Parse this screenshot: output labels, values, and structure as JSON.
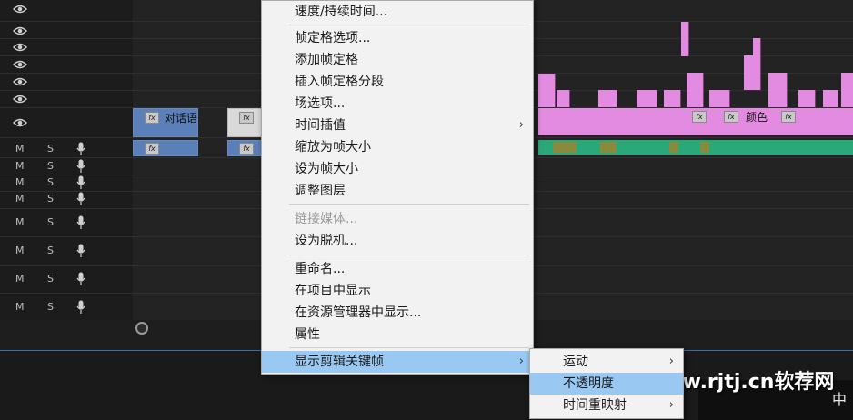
{
  "tracks": {
    "video_clip_1_label": "对话语",
    "video_clip_3_label": "颜色",
    "audio_btn_m": "M",
    "audio_btn_s": "S"
  },
  "context_menu": {
    "items": [
      {
        "label": "速度/持续时间...",
        "enabled": true
      },
      {
        "label": "帧定格选项...",
        "enabled": true
      },
      {
        "label": "添加帧定格",
        "enabled": true
      },
      {
        "label": "插入帧定格分段",
        "enabled": true
      },
      {
        "label": "场选项...",
        "enabled": true
      },
      {
        "label": "时间插值",
        "enabled": true,
        "submenu": true
      },
      {
        "label": "缩放为帧大小",
        "enabled": true
      },
      {
        "label": "设为帧大小",
        "enabled": true
      },
      {
        "label": "调整图层",
        "enabled": true
      },
      {
        "label": "链接媒体...",
        "enabled": false
      },
      {
        "label": "设为脱机...",
        "enabled": true
      },
      {
        "label": "重命名...",
        "enabled": true
      },
      {
        "label": "在项目中显示",
        "enabled": true
      },
      {
        "label": "在资源管理器中显示...",
        "enabled": true
      },
      {
        "label": "属性",
        "enabled": true
      },
      {
        "label": "显示剪辑关键帧",
        "enabled": true,
        "submenu": true,
        "highlighted": true
      }
    ]
  },
  "submenu": {
    "items": [
      {
        "label": "运动",
        "submenu": true
      },
      {
        "label": "不透明度",
        "highlighted": true
      },
      {
        "label": "时间重映射",
        "submenu": true
      }
    ]
  },
  "watermark": "www.rjtj.cn软荐网",
  "taskbar": {
    "ime": "中"
  },
  "colors": {
    "menu_bg": "#f2f2f2",
    "highlight": "#99c9f2",
    "clip_pink": "#e38be0",
    "clip_blue": "#5b7fb8",
    "audio_green": "#2ba879"
  }
}
